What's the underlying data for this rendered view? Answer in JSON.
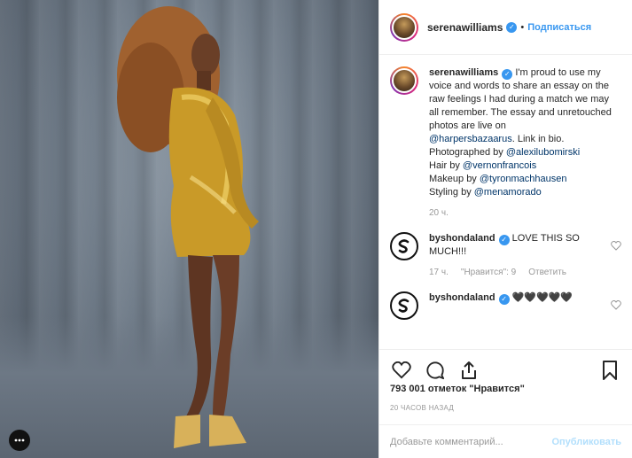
{
  "post": {
    "username": "serenawilliams",
    "follow_label": "Подписаться",
    "dot": "•",
    "caption": {
      "username": "serenawilliams",
      "lines": [
        "I'm proud to use my",
        "voice and words to share an essay on",
        "the raw feelings I had during a match",
        "we may all remember. The essay and",
        "unretouched photos are live on"
      ],
      "mention_harpers": "@harpersbazaarus",
      "after_harpers": ". Link in bio.",
      "photographed_prefix": "Photographed by ",
      "mention_photographer": "@alexilubomirski",
      "hair_prefix": "Hair by ",
      "mention_hair": "@vernonfrancois",
      "makeup_prefix": "Makeup by ",
      "mention_makeup": "@tyronmachhausen",
      "styling_prefix": "Styling by ",
      "mention_styling": "@menamorado",
      "time": "20 ч."
    },
    "comments": [
      {
        "username": "byshondaland",
        "text_line1": "LOVE THIS SO",
        "text_line2": "MUCH!!!",
        "time": "17 ч.",
        "likes": "\"Нравится\": 9",
        "reply": "Ответить"
      },
      {
        "username": "byshondaland",
        "text": "🖤🖤🖤🖤🖤"
      }
    ],
    "likes_count": "793 001 отметок \"Нравится\"",
    "timestamp": "20 ЧАСОВ НАЗАД",
    "comment_placeholder": "Добавьте комментарий...",
    "publish_label": "Опубликовать"
  },
  "colors": {
    "accent": "#3897f0",
    "text": "#262626",
    "muted": "#999999",
    "mention": "#003569"
  },
  "icons": [
    "verified-icon",
    "heart-icon",
    "comment-icon",
    "share-icon",
    "bookmark-icon",
    "more-icon",
    "shondaland-logo"
  ]
}
